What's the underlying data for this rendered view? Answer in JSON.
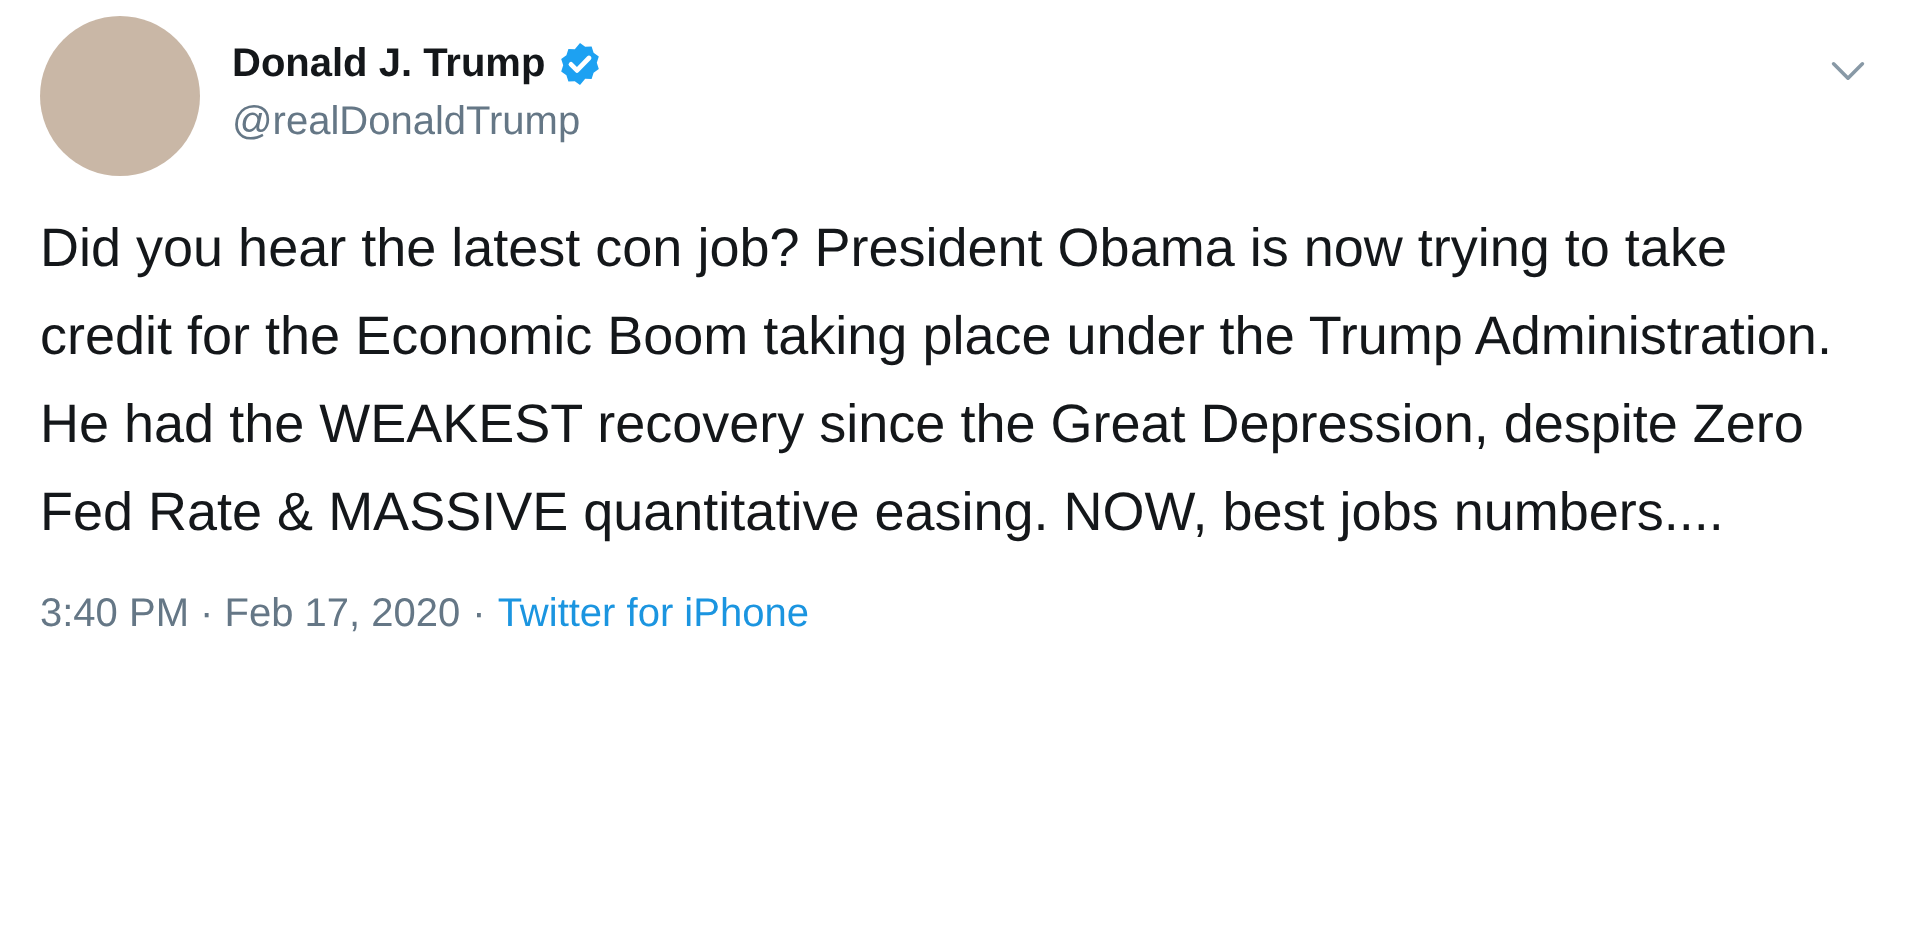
{
  "tweet": {
    "author": {
      "name": "Donald J. Trump",
      "verified": true,
      "handle": "@realDonaldTrump"
    },
    "text": "Did you hear the latest con job? President Obama is now trying to take credit for the Economic Boom taking place under the Trump Administration. He had the WEAKEST recovery since the Great Depression, despite Zero Fed Rate & MASSIVE quantitative easing. NOW, best jobs numbers....",
    "timestamp": "3:40 PM · Feb 17, 2020",
    "separator": "·",
    "source": "Twitter for iPhone"
  }
}
